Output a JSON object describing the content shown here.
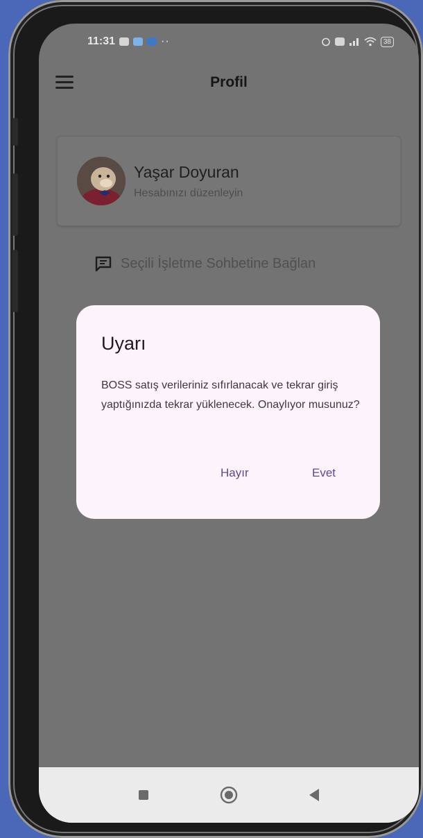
{
  "status_bar": {
    "time": "11:31",
    "left_icons": [
      "notification-icon",
      "app-icon",
      "linkedin-icon",
      "more-icon"
    ],
    "right_icons": [
      "alarm-icon",
      "sim-icon",
      "signal-icon",
      "wifi-icon",
      "battery-icon"
    ],
    "battery": "38"
  },
  "app_bar": {
    "title": "Profil",
    "menu_icon": "menu-icon"
  },
  "profile": {
    "name": "Yaşar Doyuran",
    "subtitle": "Hesabınızı düzenleyin"
  },
  "chat_link": {
    "label": "Seçili İşletme Sohbetine Bağlan",
    "icon": "chat-icon"
  },
  "dialog": {
    "title": "Uyarı",
    "message": "BOSS satış verileriniz sıfırlanacak ve tekrar giriş yaptığınızda tekrar yüklenecek. Onaylıyor musunuz?",
    "cancel_label": "Hayır",
    "confirm_label": "Evet"
  },
  "nav_bar": {
    "buttons": [
      "recents-icon",
      "home-icon",
      "back-icon"
    ]
  },
  "colors": {
    "background": "#4a67b8",
    "scrim": "#737373",
    "dialog": "#fdf3fb",
    "accent": "#5b4a94"
  }
}
